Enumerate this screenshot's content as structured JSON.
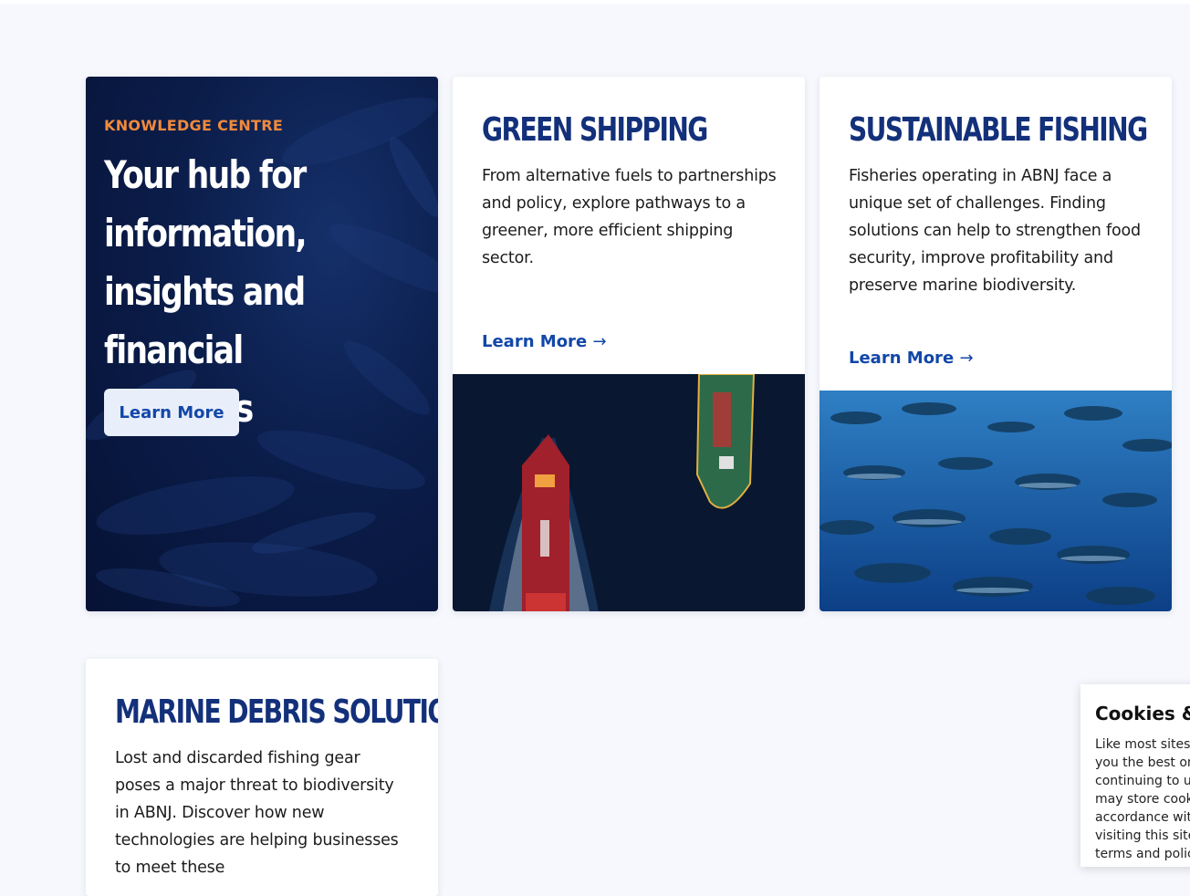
{
  "hero": {
    "eyebrow": "KNOWLEDGE CENTRE",
    "title": "Your hub for information, insights and financial solutions",
    "button_label": "Learn More"
  },
  "cards": [
    {
      "title": "GREEN SHIPPING",
      "body": "From alternative fuels to partnerships and policy, explore pathways to a greener, more efficient shipping sector.",
      "link_label": "Learn More",
      "link_arrow": "→",
      "image": "ships-aerial-image"
    },
    {
      "title": "SUSTAINABLE FISHING",
      "body": "Fisheries operating in ABNJ face a unique set of challenges. Finding solutions can help to strengthen food security, improve profitability and preserve marine biodiversity.",
      "link_label": "Learn More",
      "link_arrow": "→",
      "image": "tuna-school-image"
    },
    {
      "title": "MARINE DEBRIS SOLUTIONS",
      "body": "Lost and discarded fishing gear poses a major threat to biodiversity in ABNJ. Discover how new technologies are helping businesses to meet these"
    }
  ],
  "cookie": {
    "title": "Cookies & P",
    "text": "Like most sites, we use cookies to give you the best online experience. By continuing to use this site, you agree We may store cookies on your device in accordance with our Cookie Policy. By visiting this site, you agree to the site terms and policies."
  },
  "colors": {
    "accent_orange": "#f08a3c",
    "heading_navy": "#13307a",
    "link_blue": "#1247a8",
    "hero_bg": "#0b1d4a"
  }
}
